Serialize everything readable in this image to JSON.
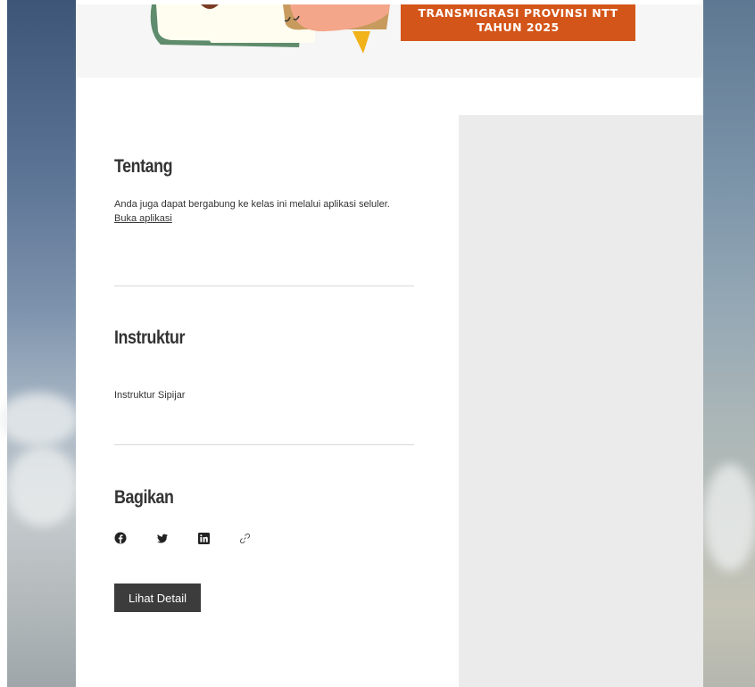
{
  "banner": {
    "line1": "TRANSMIGRASI PROVINSI NTT",
    "line2": "TAHUN 2025",
    "accent_color": "#d45519"
  },
  "about": {
    "heading": "Tentang",
    "text": "Anda juga dapat bergabung ke kelas ini melalui aplikasi seluler.",
    "link": "Buka aplikasi"
  },
  "instructor": {
    "heading": "Instruktur",
    "name": "Instruktur Sipijar"
  },
  "share": {
    "heading": "Bagikan",
    "icons": [
      "facebook-icon",
      "twitter-icon",
      "linkedin-icon",
      "link-icon"
    ]
  },
  "actions": {
    "detail_label": "Lihat Detail"
  }
}
